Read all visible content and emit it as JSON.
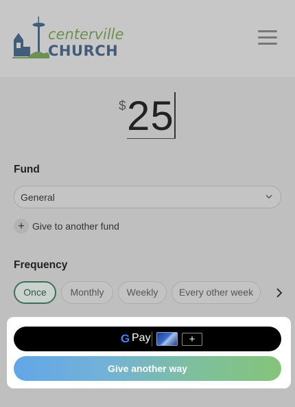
{
  "header": {
    "logo_text_top": "centerville",
    "logo_text_bottom": "CHURCH",
    "menu_icon": "hamburger-menu-icon"
  },
  "amount": {
    "currency": "$",
    "value": "25"
  },
  "fund": {
    "label": "Fund",
    "selected": "General",
    "add_another_label": "Give to another fund"
  },
  "frequency": {
    "label": "Frequency",
    "options": [
      "Once",
      "Monthly",
      "Weekly",
      "Every other week"
    ],
    "selected": "Once"
  },
  "payment": {
    "gpay_label": "Pay",
    "gpay_plus": "+",
    "other_label": "Give another way"
  },
  "colors": {
    "active_pill": "#3f6e58",
    "logo_green": "#6f8f52",
    "logo_blue": "#415d7a"
  }
}
